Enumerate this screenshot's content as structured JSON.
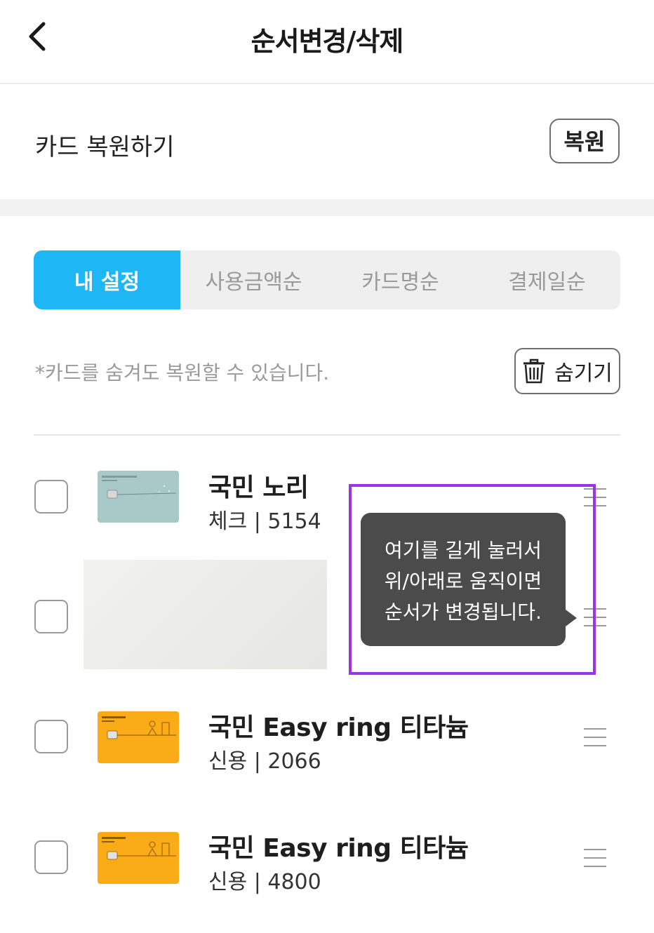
{
  "header": {
    "title": "순서변경/삭제",
    "back_icon": "chevron-left-icon"
  },
  "restore": {
    "label": "카드 복원하기",
    "button_label": "복원"
  },
  "sort_tabs": [
    {
      "label": "내 설정",
      "active": true
    },
    {
      "label": "사용금액순",
      "active": false
    },
    {
      "label": "카드명순",
      "active": false
    },
    {
      "label": "결제일순",
      "active": false
    }
  ],
  "notice": {
    "text": "*카드를 숨겨도 복원할 수 있습니다.",
    "hide_button_label": "숨기기",
    "hide_button_icon": "trash-icon"
  },
  "cards": [
    {
      "name": "국민 노리",
      "meta": "체크 | 5154",
      "checked": false,
      "thumb": "teal",
      "visible": true
    },
    {
      "name": "",
      "meta": "",
      "checked": false,
      "thumb": "redacted",
      "visible": false
    },
    {
      "name": "국민 Easy ring 티타늄",
      "meta": "신용 | 2066",
      "checked": false,
      "thumb": "orange",
      "visible": true
    },
    {
      "name": "국민 Easy ring 티타늄",
      "meta": "신용 | 4800",
      "checked": false,
      "thumb": "orange",
      "visible": true
    }
  ],
  "tooltip": {
    "lines": [
      "여기를 길게 눌러서",
      "위/아래로 움직이면",
      "순서가 변경됩니다."
    ]
  },
  "colors": {
    "accent": "#1fb6f6",
    "highlight": "#9b33e6",
    "tooltip_bg": "#4b4b4b",
    "card_teal": "#a7c8c8",
    "card_orange": "#f9ab18"
  }
}
